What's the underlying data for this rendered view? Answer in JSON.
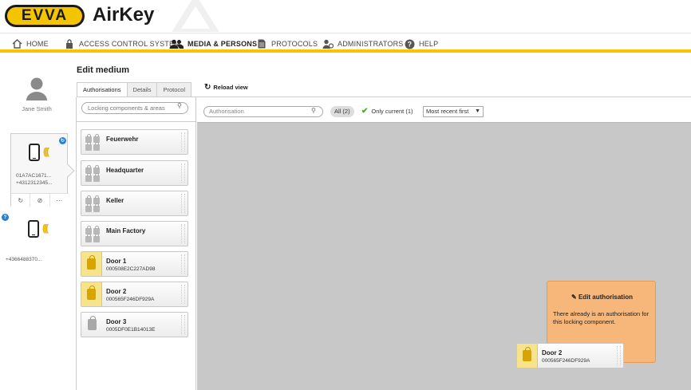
{
  "header": {
    "logo": "EVVA",
    "app_name": "AirKey"
  },
  "nav": [
    {
      "label": "HOME",
      "icon": "home-icon"
    },
    {
      "label": "ACCESS CONTROL SYSTEM",
      "icon": "lock-icon"
    },
    {
      "label": "MEDIA & PERSONS",
      "icon": "persons-icon",
      "active": true
    },
    {
      "label": "PROTOCOLS",
      "icon": "document-icon"
    },
    {
      "label": "ADMINISTRATORS",
      "icon": "admin-icon"
    },
    {
      "label": "HELP",
      "icon": "help-icon"
    }
  ],
  "person": {
    "name": "Jane Smith"
  },
  "media": [
    {
      "id_line1": "01A7AC1671...",
      "id_line2": "+4312312345...",
      "selected": true
    },
    {
      "id_line1": "+4366488370...",
      "selected": false
    }
  ],
  "edit_medium": {
    "title": "Edit medium",
    "tabs": [
      "Authorisations",
      "Details",
      "Protocol"
    ],
    "active_tab": "Authorisations",
    "reload_label": "Reload view"
  },
  "locking_search": {
    "placeholder": "Locking components & areas"
  },
  "locking_items": [
    {
      "name": "Feuerwehr",
      "type": "area"
    },
    {
      "name": "Headquarter",
      "type": "area"
    },
    {
      "name": "Keller",
      "type": "area"
    },
    {
      "name": "Main Factory",
      "type": "area"
    },
    {
      "name": "Door 1",
      "serial": "000508E2C227AD98",
      "type": "door",
      "highlight": true
    },
    {
      "name": "Door 2",
      "serial": "000565F246DF929A",
      "type": "door",
      "highlight": true
    },
    {
      "name": "Door 3",
      "serial": "0005DF0E1B14013E",
      "type": "door",
      "highlight": false
    }
  ],
  "auth_filter": {
    "search_placeholder": "Authorisation",
    "all_label": "All (2)",
    "only_current_label": "Only current (1)",
    "sort_value": "Most recent first"
  },
  "edit_authorisation": {
    "title": "Edit authorisation",
    "message": "There already is an authorisation for this locking component."
  },
  "drag_item": {
    "name": "Door 2",
    "serial": "000565F246DF929A"
  },
  "colors": {
    "brand_yellow": "#f5c400",
    "popup_orange": "#f8b77a",
    "canvas_gray": "#c8c8c8",
    "check_green": "#4aa832",
    "badge_blue": "#2a7fd0"
  }
}
